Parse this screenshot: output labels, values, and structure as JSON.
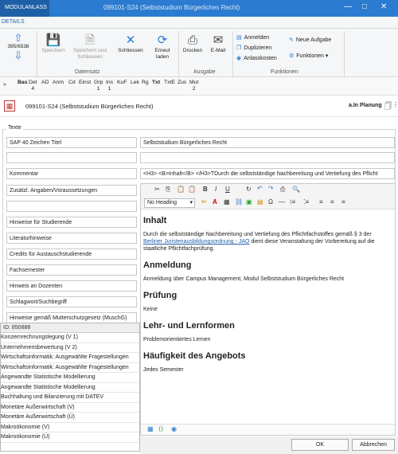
{
  "window": {
    "module_tab": "MODULANLASS",
    "title": "099101-S24 (Selbststudium Bürgerliches Recht)",
    "minimize": "—",
    "maximize": "□",
    "close": "✕"
  },
  "ribbon": {
    "tab": "DETAILS",
    "record_counter": "395/6538",
    "buttons": {
      "speichern": "Speichern",
      "speichern_schliessen": "Speichern und Schliessen",
      "schliessen": "Schliessen",
      "erneut_laden": "Erneut laden",
      "drucken": "Drucken",
      "email": "E-Mail",
      "anmelden": "Anmelden",
      "duplizieren": "Duplizieren",
      "anlasskosten": "Anlasskosten",
      "neue_aufgabe": "Neue Aufgabe",
      "funktionen": "Funktionen ▾"
    },
    "groups": {
      "datensatz": "Datensatz",
      "ausgabe": "Ausgabe",
      "funktionen": "Funktionen"
    }
  },
  "fieldbar": [
    {
      "label": "Bas",
      "sub": ""
    },
    {
      "label": "Det",
      "sub": "4"
    },
    {
      "label": "AD",
      "sub": ""
    },
    {
      "label": "Anm",
      "sub": ""
    },
    {
      "label": "Cd",
      "sub": ""
    },
    {
      "label": "Einst",
      "sub": ""
    },
    {
      "label": "Grp",
      "sub": "1"
    },
    {
      "label": "Ins",
      "sub": "1"
    },
    {
      "label": "KuF",
      "sub": ""
    },
    {
      "label": "Lek",
      "sub": ""
    },
    {
      "label": "Rg",
      "sub": ""
    },
    {
      "label": "Txt",
      "sub": ""
    },
    {
      "label": "TxtE",
      "sub": ""
    },
    {
      "label": "Zus",
      "sub": ""
    },
    {
      "label": "Mut",
      "sub": "2"
    }
  ],
  "record": {
    "title": "099101-S24 (Selbststudium Bürgerliches Recht)",
    "status": "a.In Planung"
  },
  "section": {
    "texte": "Texte"
  },
  "fields": {
    "sap_label": "SAP 40 Zeichen Titel",
    "sap_value": "Selbststudium Bürgerliches Recht",
    "kommentar_label": "Kommentar",
    "kommentar_value": "<H3> <B>Inhalt</B> </H3>TDurch die selbstständige Nachbereitung und Vertiefung des Pflicht",
    "zusatz_label": "Zusätzl. Angaben/Voraussetzungen",
    "hinweise_label": "Hinweise für Studierende",
    "literatur_label": "Literaturhinweise",
    "credits_label": "Credits für Austauschstudierende",
    "fachsemester_label": "Fachsemester",
    "dozenten_label": "Hinweis an Dozenten",
    "schlagwort_label": "Schlagwort/Suchbegriff",
    "mutterschutz_label": "Hinweise gemäß Mutterschutzgesetz (MuschG)"
  },
  "editor": {
    "heading_select": "No Heading",
    "content": {
      "h1": "Inhalt",
      "p1a": "Durch die selbstständige Nachbereitung und Vertiefung des Pflichtfachstoffes gemäß § 3 der ",
      "p1link": "Berliner Juristenausbildungsordnung - JAO",
      "p1b": " dient diese Veranstaltung der Vorbereitung auf die staatliche Pflichtfachprüfung.",
      "h2": "Anmeldung",
      "p2": "Anmeldung über Campus Management, Modul Selbststudium Bürgerliches Recht",
      "h3": "Prüfung",
      "p3": "Keine",
      "h4": "Lehr- und Lernformen",
      "p4": "Problemorientiertes Lernen",
      "h5": "Häufigkeit des Angebots",
      "p5": "Jedes Semester"
    }
  },
  "dropdown": {
    "id": "ID: 850888",
    "items": [
      "Konzernrechnungslegung (V 1)",
      "Unternehmensbewertung (V 2)",
      "Wirtschaftsinformatik: Ausgewählte Fragestellungen",
      "Wirtschaftsinformatik: Ausgewählte Fragestellungen",
      "Angewandte Statistische Modellierung",
      "Angewandte Statistische Modellierung",
      "Buchhaltung und Bilanzierung mit DATEV",
      "Monetäre Außenwirtschaft (V)",
      "Monetäre Außenwirtschaft (Ü)",
      "Makroökonomie (V)",
      "Makroökonomie (Ü)"
    ]
  },
  "footer": {
    "ok": "OK",
    "cancel": "Abbrechen"
  }
}
